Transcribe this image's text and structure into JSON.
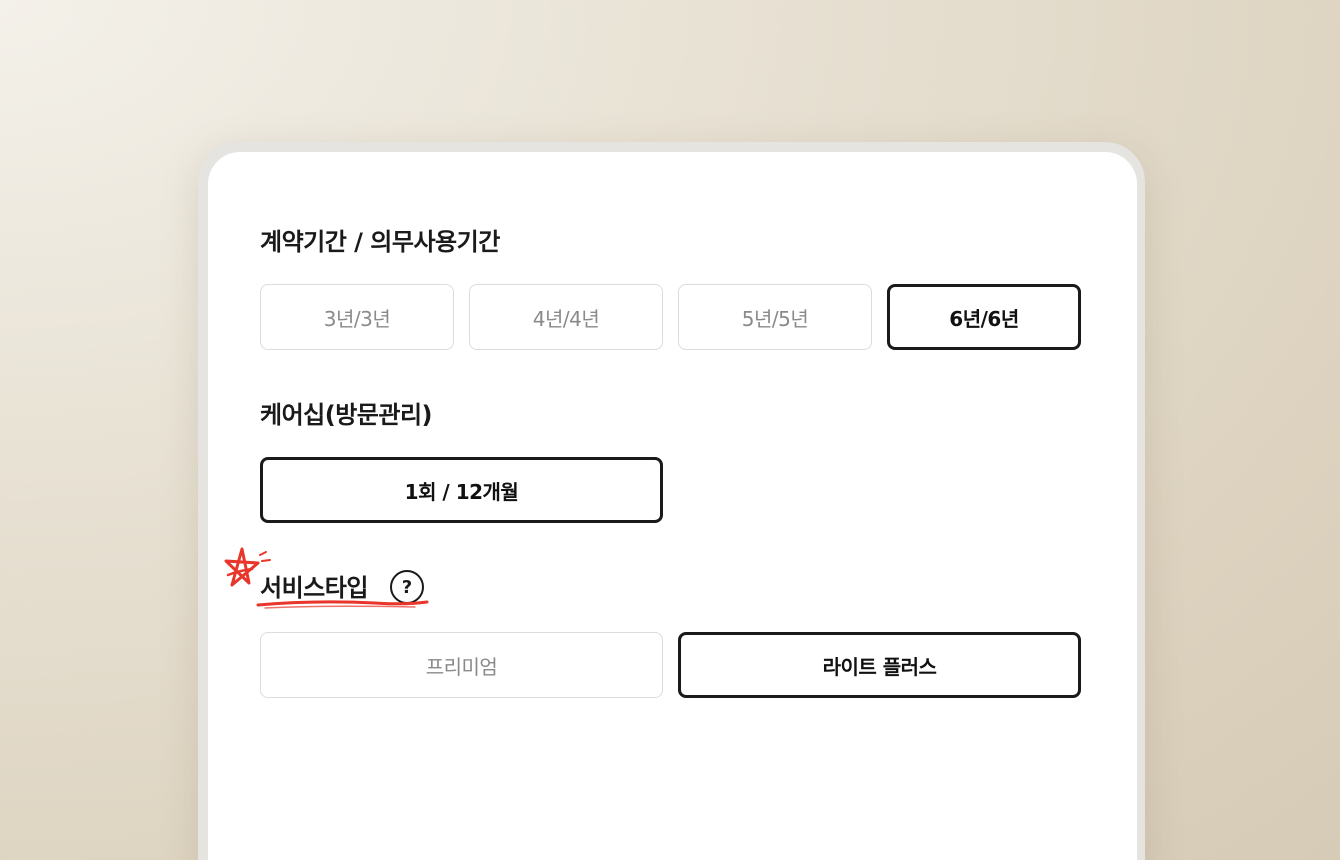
{
  "contract": {
    "title": "계약기간 / 의무사용기간",
    "options": [
      {
        "label": "3년/3년",
        "selected": false
      },
      {
        "label": "4년/4년",
        "selected": false
      },
      {
        "label": "5년/5년",
        "selected": false
      },
      {
        "label": "6년/6년",
        "selected": true
      }
    ]
  },
  "careship": {
    "title": "케어십(방문관리)",
    "options": [
      {
        "label": "1회 / 12개월",
        "selected": true
      }
    ]
  },
  "service_type": {
    "title": "서비스타입",
    "help_icon": "question-circle-icon",
    "help_glyph": "?",
    "decoration_icon": "star-doodle-icon",
    "accent_color": "#e8362a",
    "options": [
      {
        "label": "프리미엄",
        "selected": false
      },
      {
        "label": "라이트 플러스",
        "selected": true
      }
    ]
  }
}
